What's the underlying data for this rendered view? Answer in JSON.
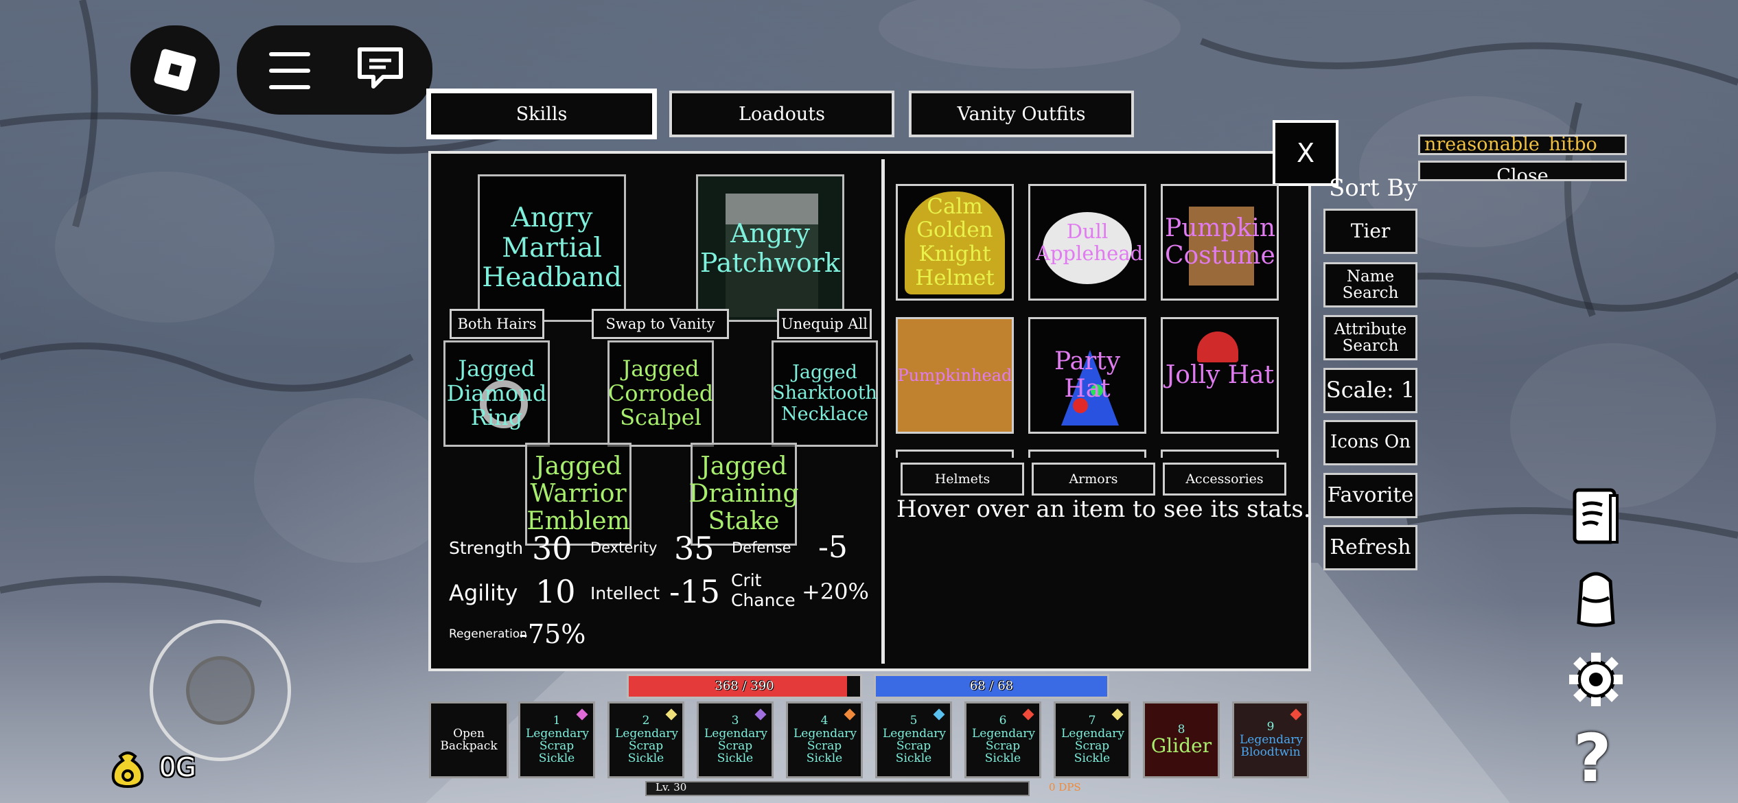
{
  "tabs": {
    "skills": "Skills",
    "loadouts": "Loadouts",
    "vanity": "Vanity Outfits"
  },
  "close_button": "X",
  "equipment": {
    "head": "Angry Martial Headband",
    "body": "Angry Patchwork",
    "actions": {
      "both_hairs": "Both Hairs",
      "swap_vanity": "Swap to Vanity",
      "unequip_all": "Unequip All"
    },
    "ring": "Jagged Diamond Ring",
    "weapon": "Jagged Corroded Scalpel",
    "necklace": "Jagged Sharktooth Necklace",
    "emblem": "Jagged Warrior Emblem",
    "stake": "Jagged Draining Stake"
  },
  "stats": {
    "strength_label": "Strength",
    "strength": "30",
    "dexterity_label": "Dexterity",
    "dexterity": "35",
    "defense_label": "Defense",
    "defense": "-5",
    "agility_label": "Agility",
    "agility": "10",
    "intellect_label": "Intellect",
    "intellect": "-15",
    "crit_label": "Crit Chance",
    "crit": "+20%",
    "regen_label": "Regeneration",
    "regen": "-75%"
  },
  "inventory": {
    "items": [
      {
        "name": "Calm Golden Knight Helmet",
        "color": "#f0d24a"
      },
      {
        "name": "Dull Applehead",
        "color": "#e07bf0"
      },
      {
        "name": "Pumpkin Costume",
        "color": "#e07bf0"
      },
      {
        "name": "Pumpkinhead",
        "color": "#e07bf0"
      },
      {
        "name": "Party Hat",
        "color": "#e07bf0"
      },
      {
        "name": "Jolly Hat",
        "color": "#e07bf0"
      }
    ],
    "categories": {
      "helmets": "Helmets",
      "armors": "Armors",
      "accessories": "Accessories"
    },
    "hint": "Hover over an item to see its stats."
  },
  "side": {
    "search_value": "nreasonable_hitbo",
    "close": "Close",
    "sort_by": "Sort By",
    "tier": "Tier",
    "name_search": "Name Search",
    "attribute_search": "Attribute Search",
    "scale": "Scale: 1",
    "icons_on": "Icons On",
    "favorite": "Favorite",
    "refresh": "Refresh"
  },
  "bars": {
    "health": "368 / 390",
    "health_fraction": 0.944,
    "mana": "68 / 68",
    "mana_fraction": 1.0,
    "level": "Lv. 30",
    "dps": "0 DPS"
  },
  "hotbar": {
    "open_backpack": "Open Backpack",
    "slots": [
      {
        "num": "1",
        "label": "Legendary Scrap Sickle",
        "gem": "#e06ad8"
      },
      {
        "num": "2",
        "label": "Legendary Scrap Sickle",
        "gem": "#f0e07a"
      },
      {
        "num": "3",
        "label": "Legendary Scrap Sickle",
        "gem": "#a070e0"
      },
      {
        "num": "4",
        "label": "Legendary Scrap Sickle",
        "gem": "#f08a3a"
      },
      {
        "num": "5",
        "label": "Legendary Scrap Sickle",
        "gem": "#5ac0f0"
      },
      {
        "num": "6",
        "label": "Legendary Scrap Sickle",
        "gem": "#f04a3a"
      },
      {
        "num": "7",
        "label": "Legendary Scrap Sickle",
        "gem": "#f0e07a"
      },
      {
        "num": "8",
        "label": "Glider",
        "gem": ""
      },
      {
        "num": "9",
        "label": "Legendary Bloodtwin",
        "gem": "#f04a3a"
      }
    ]
  },
  "currency": "0G"
}
